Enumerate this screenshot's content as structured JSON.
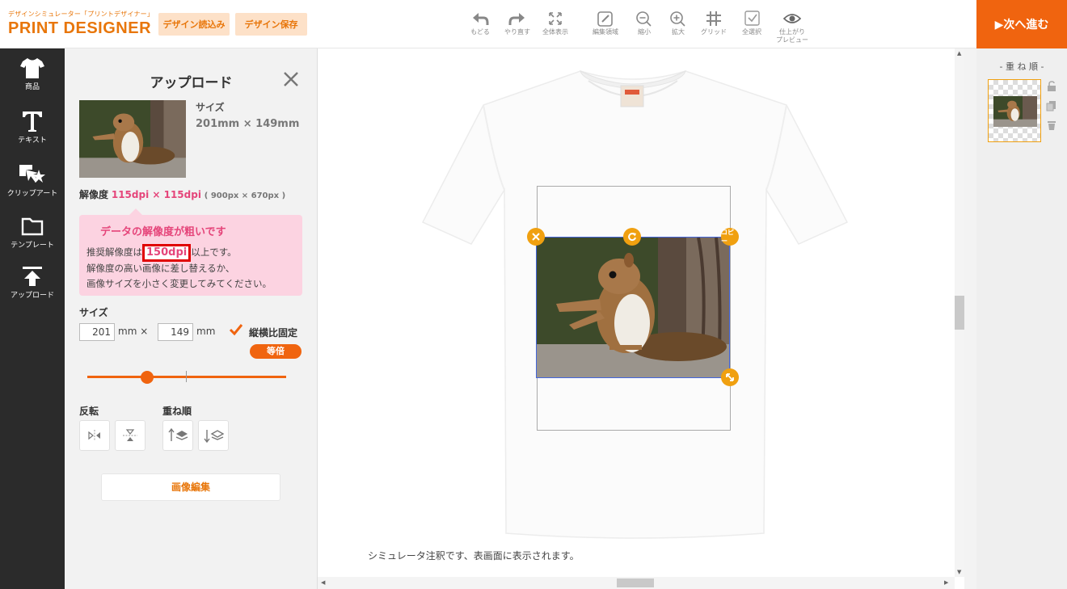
{
  "header": {
    "brand_sub": "デザインシミュレーター「プリントデザイナー」",
    "brand_main": "PRINT DESIGNER",
    "load_button": "デザイン読込み",
    "save_button": "デザイン保存",
    "tools": [
      {
        "label": "もどる",
        "icon": "undo-icon"
      },
      {
        "label": "やり直す",
        "icon": "redo-icon"
      },
      {
        "label": "全体表示",
        "icon": "fit-all-icon"
      },
      {
        "label": "編集領域",
        "icon": "edit-area-icon"
      },
      {
        "label": "縮小",
        "icon": "zoom-out-icon"
      },
      {
        "label": "拡大",
        "icon": "zoom-in-icon"
      },
      {
        "label": "グリッド",
        "icon": "grid-icon"
      },
      {
        "label": "全選択",
        "icon": "select-all-icon"
      },
      {
        "label": "仕上がり",
        "label2": "プレビュー",
        "icon": "eye-icon"
      }
    ],
    "next_button": "▶次へ進む"
  },
  "leftnav": {
    "items": [
      {
        "label": "商品",
        "icon": "tshirt-icon"
      },
      {
        "label": "テキスト",
        "icon": "text-icon"
      },
      {
        "label": "クリップアート",
        "icon": "clipart-icon"
      },
      {
        "label": "テンプレート",
        "icon": "folder-icon"
      },
      {
        "label": "アップロード",
        "icon": "upload-icon"
      }
    ]
  },
  "panel": {
    "title": "アップロード",
    "size_label": "サイズ",
    "size_value": "201mm × 149mm",
    "resolution_label": "解像度",
    "resolution_value": "115dpi × 115dpi",
    "resolution_px": "( 900px × 670px )",
    "warning": {
      "title": "データの解像度が粗いです",
      "line1_pre": "推奨解像度は",
      "line1_highlight": "150dpi",
      "line1_post": "以上です。",
      "line2": "解像度の高い画像に差し替えるか、",
      "line3": "画像サイズを小さく変更してみてください。"
    },
    "size_section_label": "サイズ",
    "width_value": "201",
    "height_value": "149",
    "unit_mm_x": "mm ×",
    "unit_mm": "mm",
    "aspect_lock_label": "縦横比固定",
    "aspect_lock_checked": true,
    "equal_button": "等倍",
    "slider_value_percent": 30,
    "flip_label": "反転",
    "order_label": "重ね順",
    "edit_button": "画像編集"
  },
  "canvas": {
    "note": "シミュレータ注釈です、表画面に表示されます。",
    "copy_handle": "コピー"
  },
  "rightpanel": {
    "title": "- 重 ね 順 -"
  },
  "colors": {
    "accent": "#f0640f",
    "brand": "#e8760a",
    "warning_bg": "#fcd3e1",
    "warning_text": "#e5457a",
    "handle": "#f0a010",
    "selection": "#4466dd"
  }
}
